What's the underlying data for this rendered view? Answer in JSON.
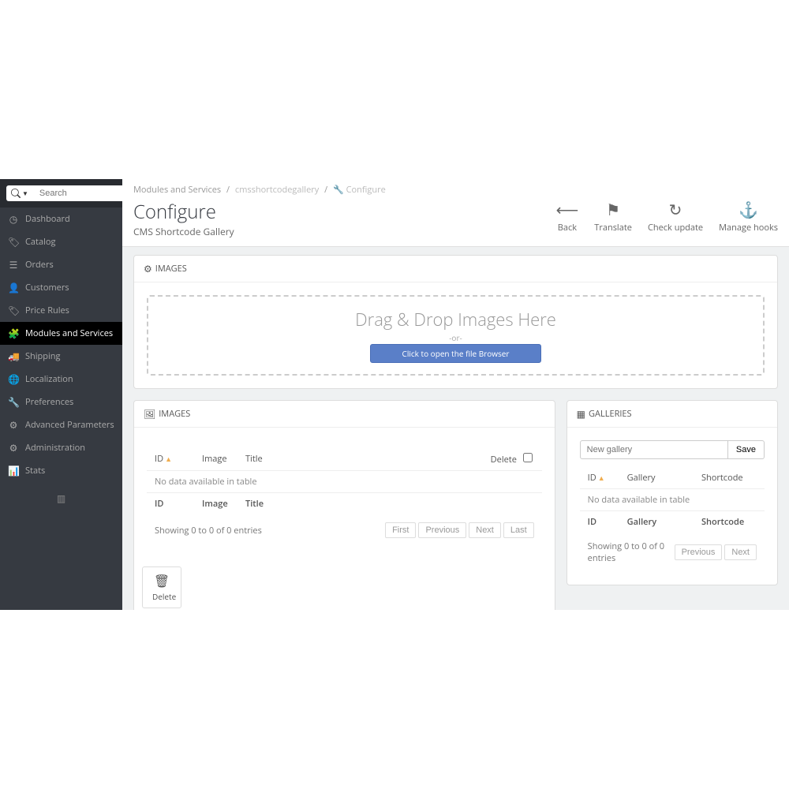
{
  "search": {
    "placeholder": "Search"
  },
  "sidebar": {
    "items": [
      {
        "label": "Dashboard"
      },
      {
        "label": "Catalog"
      },
      {
        "label": "Orders"
      },
      {
        "label": "Customers"
      },
      {
        "label": "Price Rules"
      },
      {
        "label": "Modules and Services"
      },
      {
        "label": "Shipping"
      },
      {
        "label": "Localization"
      },
      {
        "label": "Preferences"
      },
      {
        "label": "Advanced Parameters"
      },
      {
        "label": "Administration"
      },
      {
        "label": "Stats"
      }
    ]
  },
  "breadcrumb": {
    "a": "Modules and Services",
    "b": "cmsshortcodegallery",
    "c": "Configure"
  },
  "title": "Configure",
  "subtitle": "CMS Shortcode Gallery",
  "actions": {
    "back": "Back",
    "translate": "Translate",
    "check": "Check update",
    "hooks": "Manage hooks"
  },
  "panels": {
    "images_h": "IMAGES",
    "galleries_h": "GALLERIES"
  },
  "dropzone": {
    "main": "Drag & Drop Images Here",
    "or": "-or-",
    "btn": "Click to open the file Browser"
  },
  "images_table": {
    "cols": {
      "id": "ID",
      "image": "Image",
      "title": "Title",
      "delete": "Delete"
    },
    "empty": "No data available in table",
    "info": "Showing 0 to 0 of 0 entries",
    "pag": {
      "first": "First",
      "prev": "Previous",
      "next": "Next",
      "last": "Last"
    }
  },
  "delete_btn": "Delete",
  "galleries_table": {
    "new_ph": "New gallery",
    "save": "Save",
    "cols": {
      "id": "ID",
      "gallery": "Gallery",
      "shortcode": "Shortcode"
    },
    "empty": "No data available in table",
    "info": "Showing 0 to 0 of 0 entries",
    "pag": {
      "prev": "Previous",
      "next": "Next"
    }
  }
}
